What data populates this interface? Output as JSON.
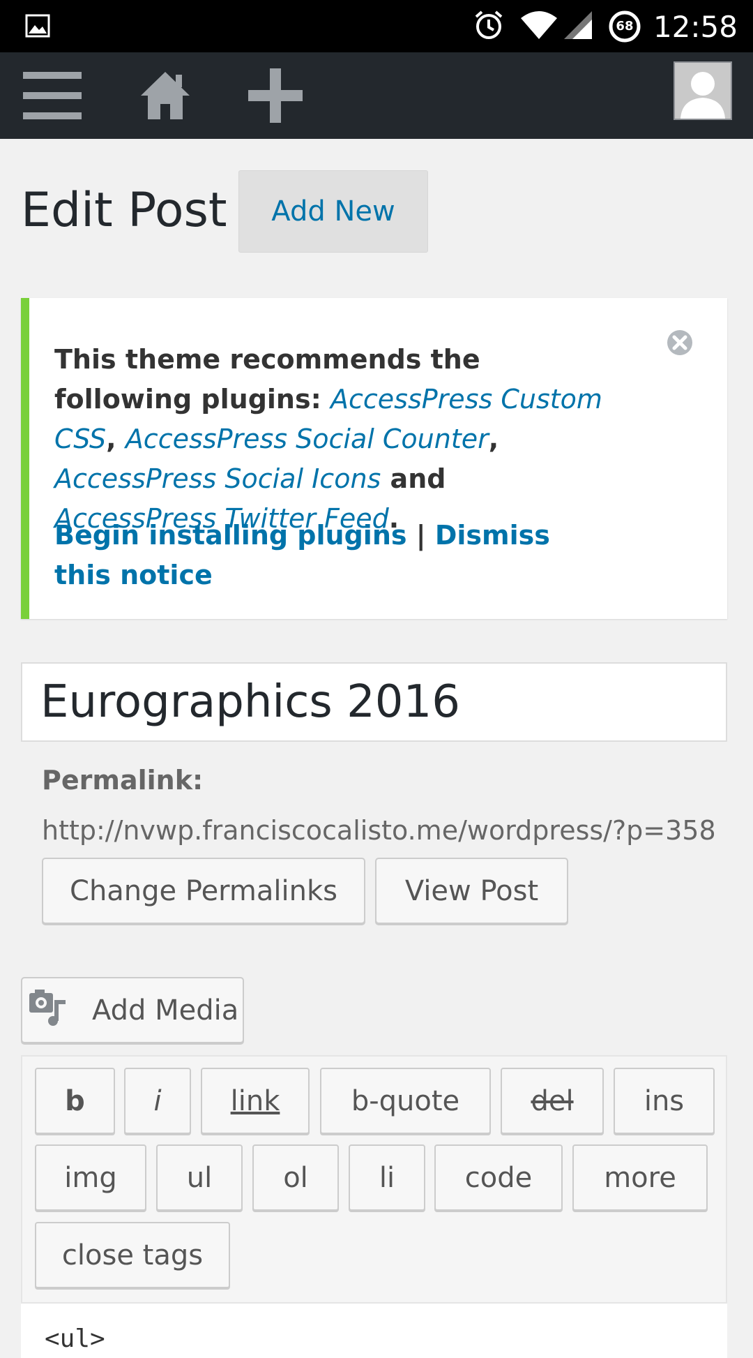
{
  "status_bar": {
    "time": "12:58",
    "battery_level": "68",
    "icons": [
      "image-icon",
      "alarm-icon",
      "wifi-icon",
      "signal-icon",
      "battery-icon"
    ]
  },
  "admin_bar": {
    "icons": [
      "menu-icon",
      "home-icon",
      "plus-icon",
      "avatar-icon"
    ],
    "background": "#23282d"
  },
  "page": {
    "title": "Edit Post",
    "add_new_label": "Add New"
  },
  "notice": {
    "intro": "This theme recommends the following plugins: ",
    "plugin_1": "AccessPress Custom CSS",
    "sep_1": ", ",
    "plugin_2": "AccessPress Social Counter",
    "sep_2": ", ",
    "plugin_3": "AccessPress Social Icons",
    "sep_3": " and ",
    "plugin_4": "AccessPress Twitter Feed",
    "end": ".",
    "install_label": "Begin installing plugins",
    "divider": " | ",
    "dismiss_label": "Dismiss this notice",
    "accent_color": "#7ad03a",
    "link_color": "#0073aa"
  },
  "post": {
    "title_value": "Eurographics 2016",
    "permalink_label": "Permalink:",
    "permalink_url": "http://nvwp.franciscocalisto.me/wordpress/?p=358",
    "change_permalinks_label": "Change Permalinks",
    "view_post_label": "View Post",
    "add_media_label": "Add Media"
  },
  "quicktags": {
    "b": "b",
    "i": "i",
    "link": "link",
    "bquote": "b-quote",
    "del": "del",
    "ins": "ins",
    "img": "img",
    "ul": "ul",
    "ol": "ol",
    "li": "li",
    "code": "code",
    "more": "more",
    "close": "close tags"
  },
  "editor": {
    "content": "<ul>"
  }
}
